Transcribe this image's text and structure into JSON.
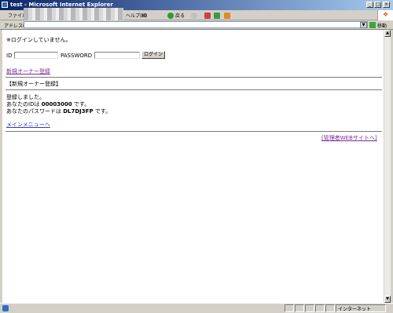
{
  "window": {
    "title": "test - Microsoft Internet Explorer"
  },
  "menu": {
    "file": "ファイル",
    "help": "ヘルプ(H)",
    "toolbar_icon": "㋇",
    "back_label": "戻る"
  },
  "address": {
    "label": "アドレス(D)",
    "go_label": "移動"
  },
  "page": {
    "login_status": "※ログインしていません。",
    "id_label": "ID",
    "password_label": "PASSWORD",
    "login_button": "ログイン",
    "new_owner_link": "新規オーナー登録",
    "section_heading": "【新規オーナー登録】",
    "registered_message": "登録しました。",
    "id_prefix": "あなたのIDは",
    "id_value": "00003000",
    "id_suffix": "です。",
    "password_prefix": "あなたのパスワードは",
    "password_value": "DL7DJ3FP",
    "password_suffix": "です。",
    "main_menu_link": "メインメニューへ",
    "admin_site_link": "[管理者WEBサイトへ]"
  },
  "status": {
    "zone": "インターネット"
  },
  "icons": [
    "ie-icon",
    "back-icon",
    "forward-icon",
    "stop-icon",
    "refresh-icon",
    "home-icon",
    "go-icon",
    "windows-logo-icon"
  ]
}
